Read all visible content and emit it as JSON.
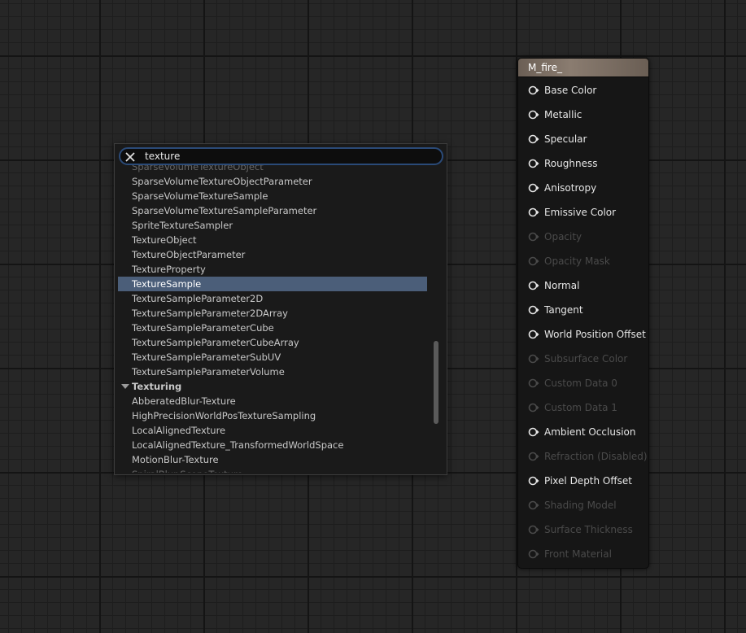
{
  "search": {
    "query": "texture"
  },
  "results": [
    {
      "label": "SparseVolumeTextureObject",
      "type": "item",
      "state": "faded"
    },
    {
      "label": "SparseVolumeTextureObjectParameter",
      "type": "item"
    },
    {
      "label": "SparseVolumeTextureSample",
      "type": "item"
    },
    {
      "label": "SparseVolumeTextureSampleParameter",
      "type": "item"
    },
    {
      "label": "SpriteTextureSampler",
      "type": "item"
    },
    {
      "label": "TextureObject",
      "type": "item"
    },
    {
      "label": "TextureObjectParameter",
      "type": "item"
    },
    {
      "label": "TextureProperty",
      "type": "item"
    },
    {
      "label": "TextureSample",
      "type": "item",
      "state": "selected"
    },
    {
      "label": "TextureSampleParameter2D",
      "type": "item"
    },
    {
      "label": "TextureSampleParameter2DArray",
      "type": "item"
    },
    {
      "label": "TextureSampleParameterCube",
      "type": "item"
    },
    {
      "label": "TextureSampleParameterCubeArray",
      "type": "item"
    },
    {
      "label": "TextureSampleParameterSubUV",
      "type": "item"
    },
    {
      "label": "TextureSampleParameterVolume",
      "type": "item"
    },
    {
      "label": "Texturing",
      "type": "category"
    },
    {
      "label": "AbberatedBlur-Texture",
      "type": "item"
    },
    {
      "label": "HighPrecisionWorldPosTextureSampling",
      "type": "item"
    },
    {
      "label": "LocalAlignedTexture",
      "type": "item"
    },
    {
      "label": "LocalAlignedTexture_TransformedWorldSpace",
      "type": "item"
    },
    {
      "label": "MotionBlur-Texture",
      "type": "item"
    },
    {
      "label": "SpiralBlur-SceneTexture",
      "type": "item",
      "state": "faded"
    }
  ],
  "node": {
    "title": "M_fire_",
    "pins": [
      {
        "label": "Base Color",
        "enabled": true
      },
      {
        "label": "Metallic",
        "enabled": true
      },
      {
        "label": "Specular",
        "enabled": true
      },
      {
        "label": "Roughness",
        "enabled": true
      },
      {
        "label": "Anisotropy",
        "enabled": true
      },
      {
        "label": "Emissive Color",
        "enabled": true
      },
      {
        "label": "Opacity",
        "enabled": false
      },
      {
        "label": "Opacity Mask",
        "enabled": false
      },
      {
        "label": "Normal",
        "enabled": true
      },
      {
        "label": "Tangent",
        "enabled": true
      },
      {
        "label": "World Position Offset",
        "enabled": true
      },
      {
        "label": "Subsurface Color",
        "enabled": false
      },
      {
        "label": "Custom Data 0",
        "enabled": false
      },
      {
        "label": "Custom Data 1",
        "enabled": false
      },
      {
        "label": "Ambient Occlusion",
        "enabled": true
      },
      {
        "label": "Refraction (Disabled)",
        "enabled": false
      },
      {
        "label": "Pixel Depth Offset",
        "enabled": true
      },
      {
        "label": "Shading Model",
        "enabled": false
      },
      {
        "label": "Surface Thickness",
        "enabled": false
      },
      {
        "label": "Front Material",
        "enabled": false
      }
    ]
  },
  "colors": {
    "selection": "#4b5e79",
    "search_border": "#2a4a78",
    "pin_enabled": "#e6e6e6",
    "pin_disabled": "#4a4a4a"
  },
  "icons": {
    "clear": "close-icon",
    "pin": "exec-pin-icon",
    "category": "triangle-down-icon"
  }
}
